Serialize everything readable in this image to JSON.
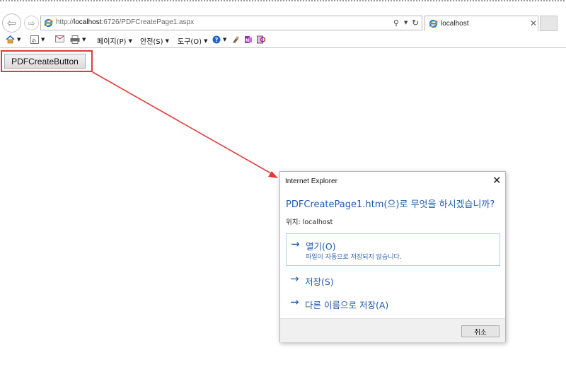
{
  "browser": {
    "url_prefix": "http://",
    "url_host": "localhost",
    "url_rest": ":6726/PDFCreatePage1.aspx",
    "tab_title": "localhost"
  },
  "commandbar": {
    "items": [
      {
        "label": "페이지(P)"
      },
      {
        "label": "안전(S)"
      },
      {
        "label": "도구(O)"
      }
    ]
  },
  "page": {
    "pdf_button_label": "PDFCreateButton"
  },
  "annotation": {
    "color": "#e03a3a"
  },
  "dialog": {
    "title": "Internet Explorer",
    "question": "PDFCreatePage1.htm(으)로 무엇을 하시겠습니까?",
    "location": "위치: localhost",
    "options": [
      {
        "label": "열기(O)",
        "sub": "파일이 자동으로 저장되지 않습니다."
      },
      {
        "label": "저장(S)"
      },
      {
        "label": "다른 이름으로 저장(A)"
      }
    ],
    "cancel_label": "취소",
    "accent_color": "#1f5bb0"
  }
}
